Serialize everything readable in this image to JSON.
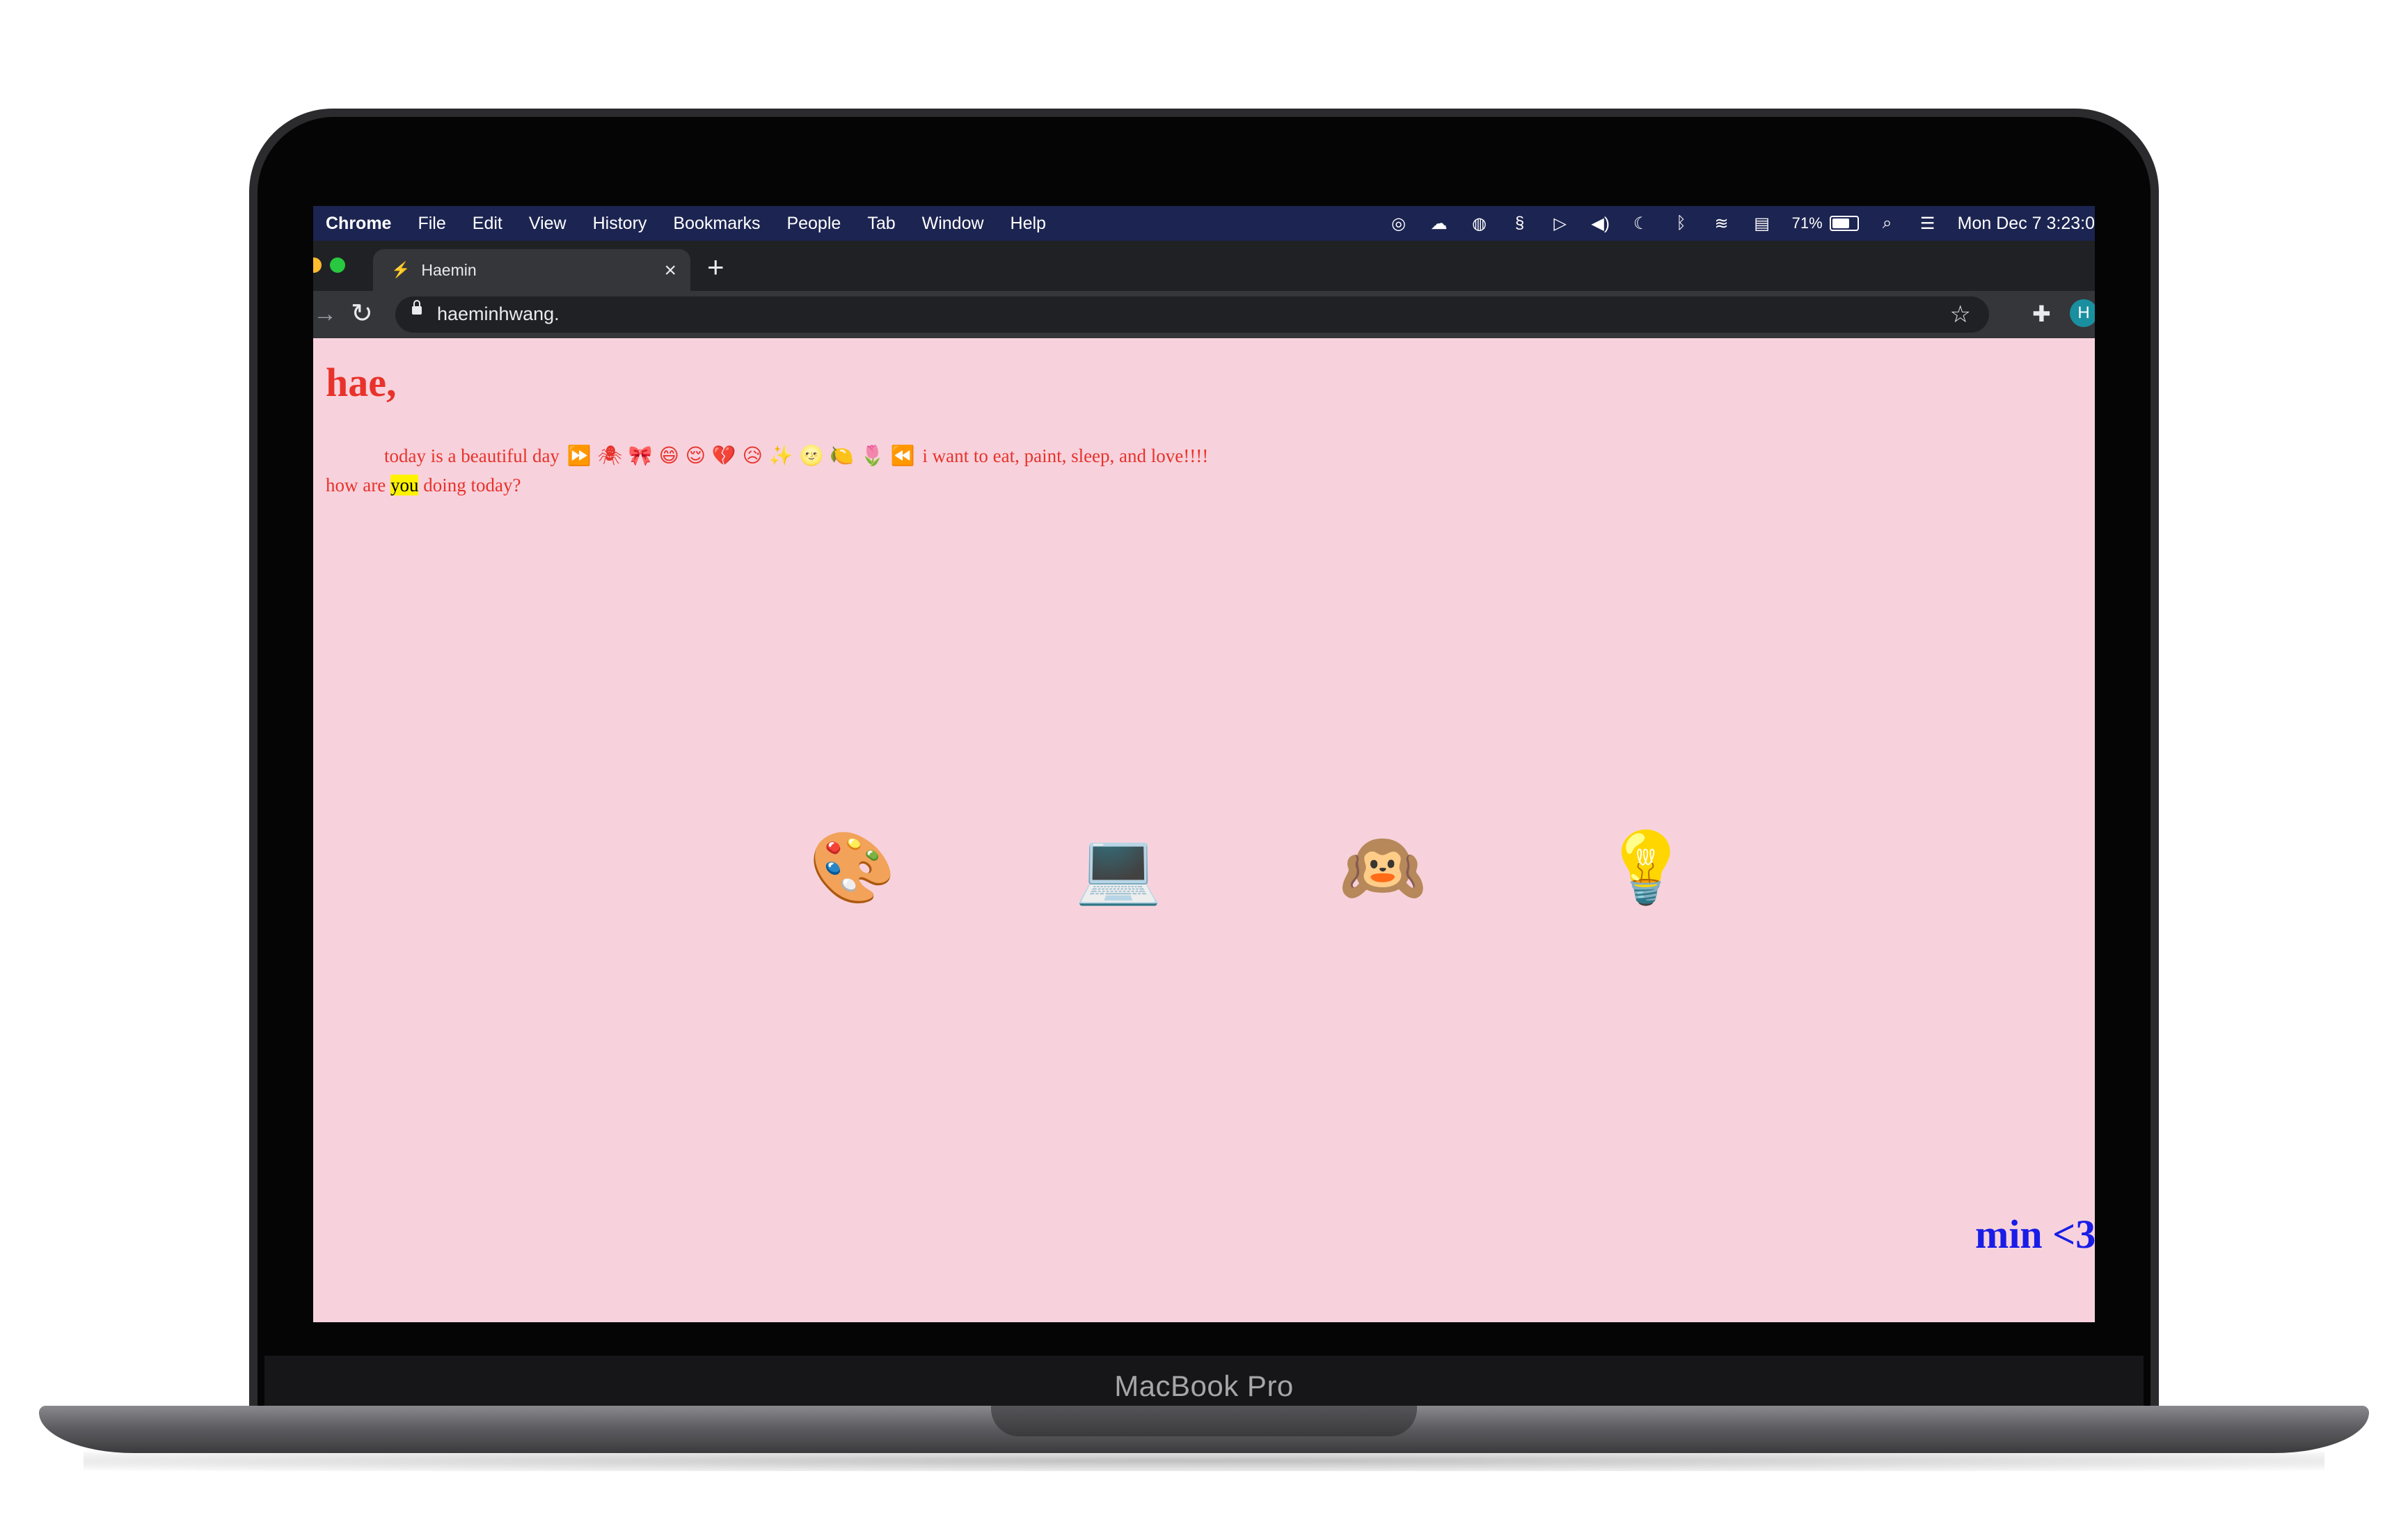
{
  "device": {
    "label": "MacBook Pro"
  },
  "menubar": {
    "app": "Chrome",
    "items": [
      "File",
      "Edit",
      "View",
      "History",
      "Bookmarks",
      "People",
      "Tab",
      "Window",
      "Help"
    ],
    "battery_pct": "71%",
    "battery_level": 0.71,
    "clock": "Mon Dec 7  3:23:0"
  },
  "browser": {
    "tab_title": "Haemin",
    "url": "haeminhwang.",
    "avatar_initial": "H"
  },
  "page": {
    "greeting": "hae,",
    "line1_before": "today is a beautiful day",
    "line1_emojis": "⏩ 🕷 🎀 😄 😌 💔 😥 ✨ 🌝 🍋 🌷 ⏪",
    "line1_after": "i want to eat, paint, sleep, and love!!!!",
    "line2_before": "how are ",
    "line2_highlight": "you",
    "line2_after": " doing today?",
    "icons": [
      {
        "glyph": "🎨",
        "name": "palette"
      },
      {
        "glyph": "💻",
        "name": "laptop"
      },
      {
        "glyph": "🙉",
        "name": "hear-no-evil-monkey"
      },
      {
        "glyph": "💡",
        "name": "light-bulb"
      }
    ],
    "signoff": "min <3"
  },
  "colors": {
    "page_bg": "#f7d2dc",
    "text_red": "#e8322b",
    "signoff_blue": "#1a1de6",
    "highlight": "#fff200",
    "menubar_bg": "#1c2451"
  }
}
